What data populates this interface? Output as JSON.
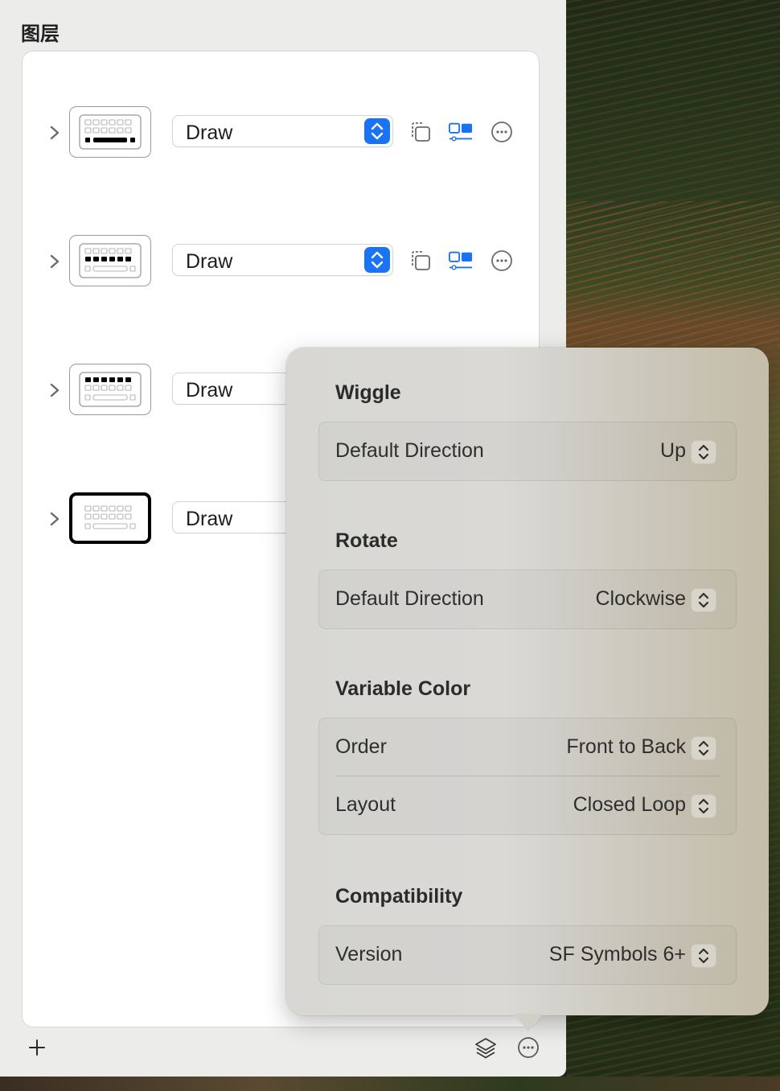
{
  "sidebar": {
    "title": "图层",
    "layers": [
      {
        "blend_mode": "Draw",
        "icon": "keyboard-bottom-row-highlight-icon"
      },
      {
        "blend_mode": "Draw",
        "icon": "keyboard-middle-row-highlight-icon"
      },
      {
        "blend_mode": "Draw",
        "icon": "keyboard-top-row-highlight-icon"
      },
      {
        "blend_mode": "Draw",
        "icon": "keyboard-frame-highlight-icon"
      }
    ],
    "footer": {
      "add": "+"
    }
  },
  "popover": {
    "sections": [
      {
        "title": "Wiggle",
        "rows": [
          {
            "label": "Default Direction",
            "value": "Up"
          }
        ]
      },
      {
        "title": "Rotate",
        "rows": [
          {
            "label": "Default Direction",
            "value": "Clockwise"
          }
        ]
      },
      {
        "title": "Variable Color",
        "rows": [
          {
            "label": "Order",
            "value": "Front to Back"
          },
          {
            "label": "Layout",
            "value": "Closed Loop"
          }
        ]
      },
      {
        "title": "Compatibility",
        "rows": [
          {
            "label": "Version",
            "value": "SF Symbols 6+"
          }
        ]
      }
    ]
  },
  "colors": {
    "accent": "#1a73f5",
    "panel": "#ececeb"
  }
}
